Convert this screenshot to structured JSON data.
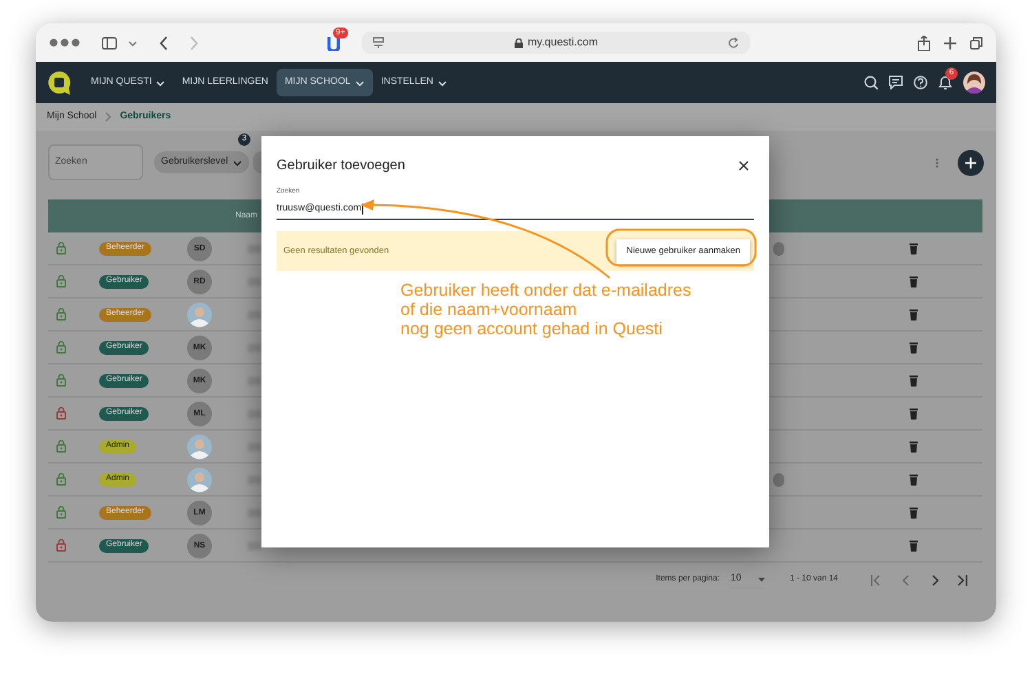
{
  "browser": {
    "url": "my.questi.com",
    "extension_badge": "9+"
  },
  "nav": {
    "items": [
      {
        "label": "MIJN QUESTI",
        "dropdown": true,
        "selected": false
      },
      {
        "label": "MIJN LEERLINGEN",
        "dropdown": false,
        "selected": false
      },
      {
        "label": "MIJN SCHOOL",
        "dropdown": true,
        "selected": true
      },
      {
        "label": "INSTELLEN",
        "dropdown": true,
        "selected": false
      }
    ],
    "notification_count": "6"
  },
  "breadcrumb": [
    {
      "label": "Mijn School",
      "current": false
    },
    {
      "label": "Gebruikers",
      "current": true
    }
  ],
  "toolbar": {
    "search_placeholder": "Zoeken",
    "filters": [
      {
        "label": "Gebruikerslevel",
        "dropdown": true
      }
    ],
    "filter_count": "3"
  },
  "table": {
    "columns": [
      {
        "label": "Naam"
      }
    ],
    "rows": [
      {
        "blocked": false,
        "role": {
          "label": "Beheerder",
          "color": "#a8741e"
        },
        "avatar": {
          "kind": "initials",
          "initials": "SD"
        },
        "tag": true
      },
      {
        "blocked": false,
        "role": {
          "label": "Gebruiker",
          "color": "#1e5a50"
        },
        "avatar": {
          "kind": "initials",
          "initials": "RD"
        },
        "tag": false
      },
      {
        "blocked": false,
        "role": {
          "label": "Beheerder",
          "color": "#a8741e"
        },
        "avatar": {
          "kind": "photo"
        },
        "tag": false
      },
      {
        "blocked": false,
        "role": {
          "label": "Gebruiker",
          "color": "#1e5a50"
        },
        "avatar": {
          "kind": "initials",
          "initials": "MK"
        },
        "tag": false
      },
      {
        "blocked": false,
        "role": {
          "label": "Gebruiker",
          "color": "#1e5a50"
        },
        "avatar": {
          "kind": "initials",
          "initials": "MK"
        },
        "tag": false
      },
      {
        "blocked": true,
        "role": {
          "label": "Gebruiker",
          "color": "#1e5a50"
        },
        "avatar": {
          "kind": "initials",
          "initials": "ML"
        },
        "tag": false
      },
      {
        "blocked": false,
        "role": {
          "label": "Admin",
          "color": "#a9ab2a"
        },
        "avatar": {
          "kind": "photo"
        },
        "tag": false
      },
      {
        "blocked": false,
        "role": {
          "label": "Admin",
          "color": "#a9ab2a"
        },
        "avatar": {
          "kind": "photo"
        },
        "tag": true
      },
      {
        "blocked": false,
        "role": {
          "label": "Beheerder",
          "color": "#a8741e"
        },
        "avatar": {
          "kind": "initials",
          "initials": "LM"
        },
        "tag": false
      },
      {
        "blocked": true,
        "role": {
          "label": "Gebruiker",
          "color": "#1e5a50"
        },
        "avatar": {
          "kind": "initials",
          "initials": "NS"
        },
        "tag": false
      }
    ]
  },
  "pagination": {
    "label": "Items per pagina:",
    "per_page": "10",
    "range": "1 - 10 van 14"
  },
  "dialog": {
    "title": "Gebruiker toevoegen",
    "field_label": "Zoeken",
    "field_value": "truusw@questi.com",
    "message": "Geen resultaten gevonden",
    "button": "Nieuwe gebruiker aanmaken"
  },
  "annotation": {
    "lines": [
      "Gebruiker heeft onder dat e-mailadres",
      "of die naam+voornaam",
      "nog geen account gehad in Questi"
    ]
  }
}
